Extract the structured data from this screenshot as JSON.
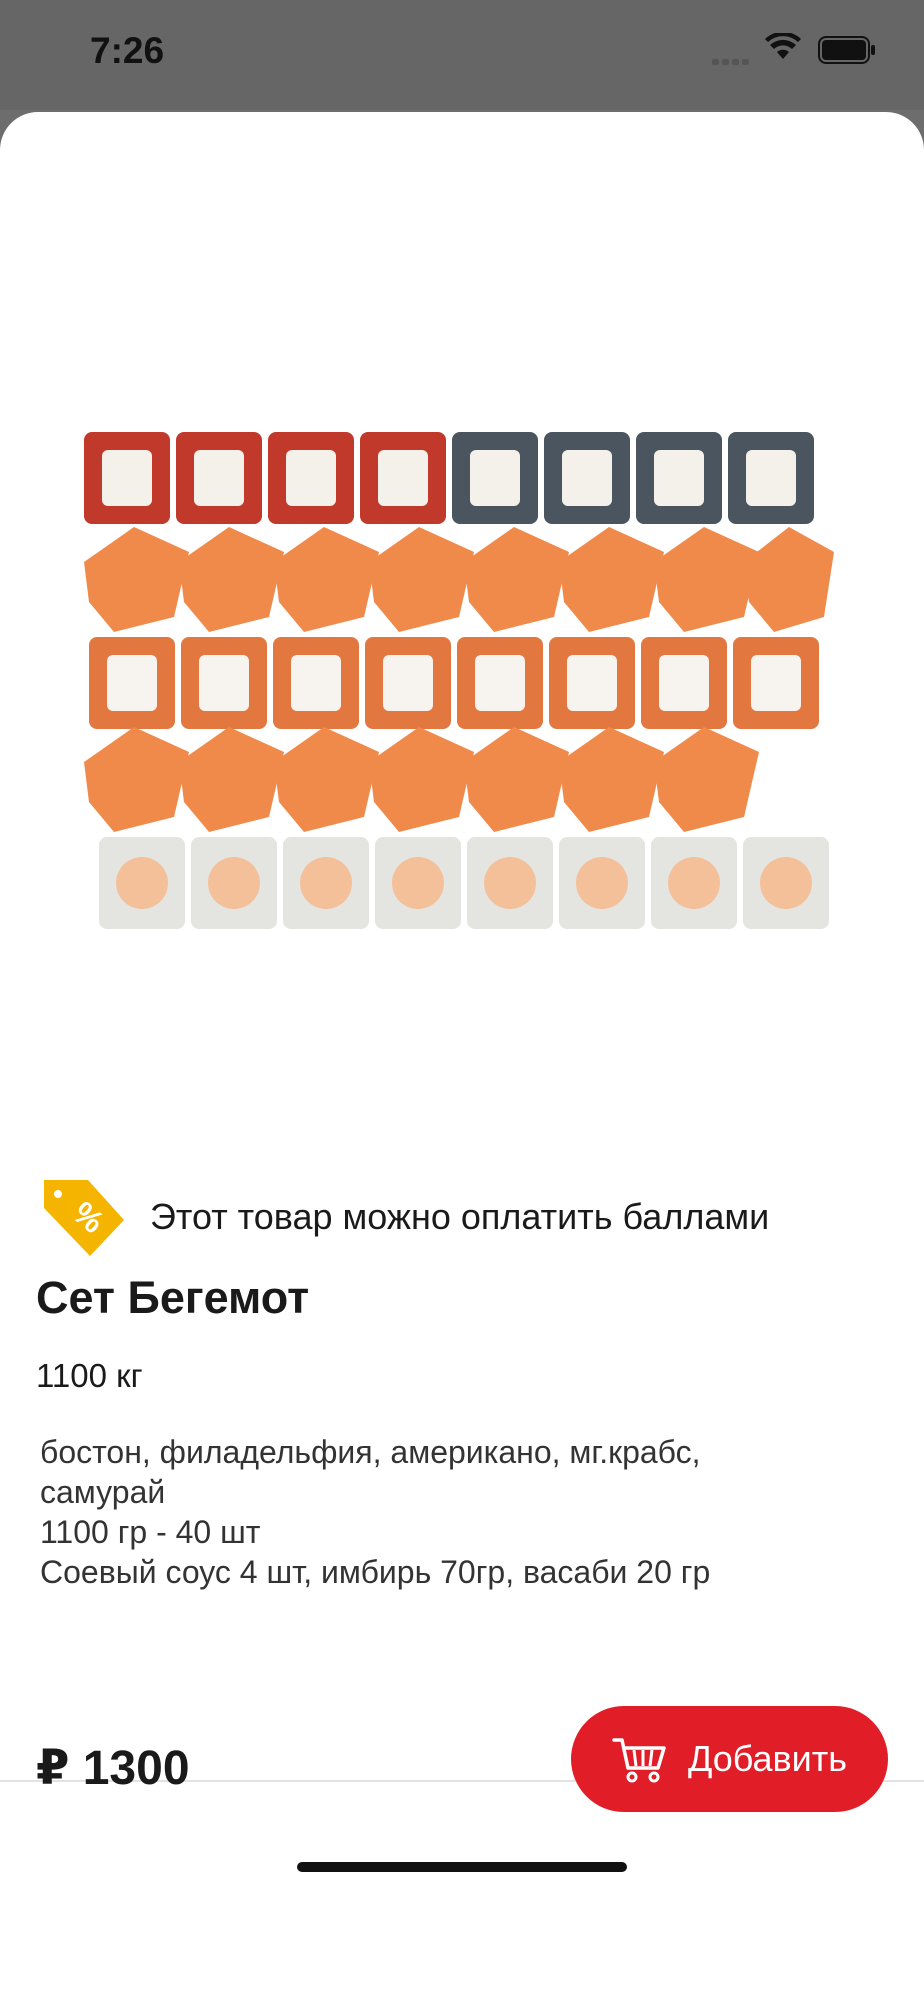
{
  "status_bar": {
    "time": "7:26"
  },
  "product": {
    "image_icon": "sushi-set-photo",
    "promo_icon": "percent-tag-icon",
    "promo_text": "Этот товар можно оплатить баллами",
    "title": "Сет Бегемот",
    "weight": "1100 кг",
    "description_lines": [
      "бостон, филадельфия, американо, мг.крабс,",
      "самурай",
      "1100 гр - 40 шт",
      "Соевый соус 4 шт, имбирь 70гр, васаби 20 гр"
    ]
  },
  "footer": {
    "price": "₽ 1300",
    "add_label": "Добавить",
    "add_icon": "cart-icon"
  },
  "colors": {
    "accent": "#e11d27",
    "promo_tag": "#f4b400"
  }
}
